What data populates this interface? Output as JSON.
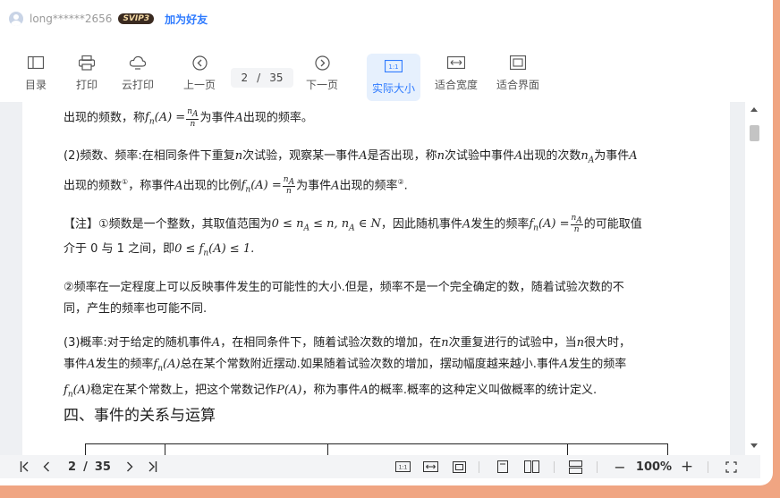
{
  "user": {
    "name": "long******2656",
    "vip_badge": "SVIP3",
    "add_friend": "加为好友"
  },
  "toolbar": {
    "catalog": "目录",
    "print": "打印",
    "cloud_print": "云打印",
    "prev_page": "上一页",
    "current_page": "2",
    "separator": "/",
    "total_pages": "35",
    "next_page": "下一页",
    "actual_size": "实际大小",
    "fit_width": "适合宽度",
    "fit_page": "适合界面",
    "actual_size_glyph": "1:1"
  },
  "document": {
    "p1_a": "出现的频数，称",
    "p1_b": "为事件",
    "p1_c": "出现的频率。",
    "p2_a": "(2)频数、频率:在相同条件下重复",
    "p2_b": "次试验，观察某一事件",
    "p2_c": "是否出现，称",
    "p2_d": "次试验中事件",
    "p2_e": "出现的次数",
    "p2_f": "为事件",
    "p2_g": "出现的频数",
    "p2_h": "，称事件",
    "p2_i": "出现的比例",
    "p2_j": "为事件",
    "p2_k": "出现的频率",
    "note_a": "【注】①频数是一个整数，其取值范围为",
    "note_b": "，因此随机事件",
    "note_c": "发生的频率",
    "note_d": "的可能取值",
    "note_e": "介于 0 与 1 之间，即",
    "note2_a": "②频率在一定程度上可以反映事件发生的可能性的大小.但是，频率不是一个完全确定的数，随着试验次数的不",
    "note2_b": "同，产生的频率也可能不同.",
    "p3_a": "(3)概率:对于给定的随机事件",
    "p3_b": "，在相同条件下，随着试验次数的增加，在",
    "p3_c": "次重复进行的试验中，当",
    "p3_d": "很大时，",
    "p3_e": "事件",
    "p3_f": "发生的频率",
    "p3_g": "总在某个常数附近摆动.如果随着试验次数的增加，摆动幅度越来越小.事件",
    "p3_h": "发生的频率",
    "p3_i": "稳定在某个常数上，把这个常数记作",
    "p3_j": "，称为事件",
    "p3_k": "的概率.概率的这种定义叫做概率的统计定义.",
    "heading": "四、事件的关系与运算",
    "sym_A": "A",
    "sym_n": "n",
    "sym_fnA": "f",
    "sym_fn_sub": "n",
    "sym_fn_tail": "(A) =",
    "frac_num": "n",
    "frac_num_sub": "A",
    "frac_den": "n",
    "sym_nA": "n",
    "sym_nA_sub": "A",
    "footnote1": "①",
    "footnote2": "②",
    "range_expr": "0 ≤ n",
    "range_expr_b": " ≤ n,  n",
    "range_expr_c": " ∈ N",
    "interval_expr": "0 ≤ f",
    "interval_expr_b": "(A) ≤ 1.",
    "fn_call": "(A)",
    "PA": "P(A)",
    "period": ".",
    "dot": "."
  },
  "bottombar": {
    "page": "2",
    "sep": "/",
    "total": "35",
    "zoom": "100%",
    "minus": "−",
    "plus": "+",
    "glyph_11": "1:1"
  }
}
